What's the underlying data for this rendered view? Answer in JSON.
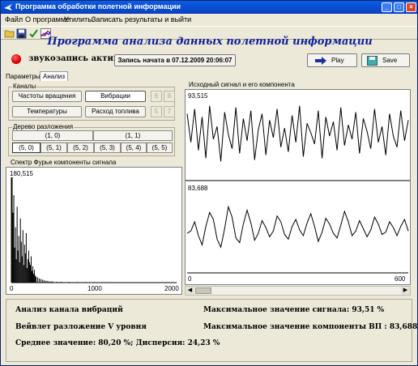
{
  "window": {
    "title": "Программа обработки полетной информации"
  },
  "menu": [
    "Файл",
    "О программе",
    "Утилиты",
    "Записать результаты и выйти"
  ],
  "toolbar_icons": [
    "open-folder-icon",
    "save-disk-icon",
    "checkmark-icon",
    "chart-icon"
  ],
  "heading": "Программа анализа данных полетной информации",
  "record": {
    "status": "звукозапись активна",
    "start_button": "Запись начата в 07.12.2009 20:06:07",
    "play": "Play",
    "save": "Save"
  },
  "tabs": [
    "Параметры",
    "Анализ"
  ],
  "channels": {
    "label": "Каналы",
    "rotation": "Частоты вращения",
    "vibration": "Вибрации",
    "temperatures": "Температуры",
    "fuel": "Расход топлива",
    "small": [
      "6",
      "8",
      "5",
      "7"
    ]
  },
  "tree": {
    "label": "Дерево разложения",
    "row1": [
      "(1, 0)",
      "(1, 1)"
    ],
    "row2": [
      "(5, 0)",
      "(5, 1)",
      "(5, 2)",
      "(5, 3)",
      "(5, 4)",
      "(5, 5)"
    ]
  },
  "spectrum": {
    "title": "Спектр Фурье компоненты сигнала",
    "max_label": "180,515",
    "x_ticks": [
      "0",
      "1000",
      "2000"
    ]
  },
  "signal": {
    "title": "Исходный сигнал и его компонента",
    "top_label": "93,515",
    "bottom_label": "83,688",
    "x_ticks": [
      "0",
      "600"
    ]
  },
  "info": {
    "line1_left": "Анализ канала вибраций",
    "line2_left": "Вейвлет разложение V уровня",
    "line3_left": "Среднее значение: 80,20 %; Дисперсия: 24,23 %",
    "line1_right": "Максимальное значение сигнала: 93,51 %",
    "line2_right": "Максимальное значение компоненты ВП : 83,688 %"
  },
  "chart_data": [
    {
      "type": "bar",
      "title": "Спектр Фурье компоненты сигнала",
      "ymax_label": "180,515",
      "x_ticks": [
        "0",
        "1000",
        "2000"
      ],
      "xlim": [
        0,
        2000
      ],
      "ylim": [
        0,
        180.515
      ],
      "x": [
        10,
        20,
        30,
        40,
        50,
        60,
        70,
        80,
        90,
        100,
        110,
        120,
        130,
        140,
        150,
        160,
        170,
        180,
        190,
        200,
        210,
        220,
        230,
        240,
        250,
        260,
        270,
        280,
        290,
        300,
        320,
        340,
        360,
        380,
        400,
        420,
        440,
        460,
        480,
        500,
        550,
        600,
        700,
        800,
        900,
        1000,
        1200,
        1400,
        1600,
        1800,
        2000
      ],
      "values": [
        180.5,
        120,
        150,
        60,
        95,
        40,
        130,
        55,
        80,
        35,
        110,
        70,
        45,
        90,
        30,
        65,
        50,
        85,
        25,
        40,
        55,
        35,
        30,
        45,
        20,
        28,
        15,
        22,
        12,
        10,
        9,
        7,
        6,
        5,
        4,
        3,
        3,
        2,
        2,
        2,
        1.5,
        1.5,
        1.2,
        1,
        1,
        0.8,
        0.8,
        0.6,
        0.6,
        0.5,
        0.5
      ]
    },
    {
      "type": "line",
      "title": "Исходный сигнал и его компонента",
      "x_ticks": [
        "0",
        "600"
      ],
      "xlim": [
        0,
        600
      ],
      "series": [
        {
          "label": "93,515",
          "values": [
            88,
            70,
            91,
            65,
            86,
            60,
            93,
            72,
            80,
            58,
            89,
            75,
            66,
            92,
            63,
            85,
            71,
            90,
            59,
            78,
            88,
            62,
            84,
            73,
            91,
            67,
            79,
            64,
            87,
            70,
            93,
            61,
            82,
            76,
            69,
            90,
            60,
            86,
            74,
            83,
            65,
            92,
            68,
            81,
            72,
            89,
            63,
            85,
            77,
            66,
            91,
            70,
            80,
            62,
            88,
            74,
            67,
            90,
            71,
            84
          ]
        },
        {
          "label": "83,688",
          "values": [
            60,
            62,
            70,
            58,
            50,
            66,
            78,
            72,
            55,
            48,
            64,
            83,
            74,
            56,
            52,
            68,
            80,
            69,
            54,
            60,
            71,
            65,
            57,
            62,
            75,
            70,
            59,
            55,
            66,
            72,
            63,
            58,
            69,
            77,
            66,
            53,
            61,
            73,
            68,
            60,
            56,
            67,
            79,
            70,
            58,
            62,
            71,
            64,
            57,
            63,
            74,
            68,
            59,
            61,
            70,
            65,
            58,
            66,
            72,
            62
          ]
        }
      ]
    }
  ]
}
